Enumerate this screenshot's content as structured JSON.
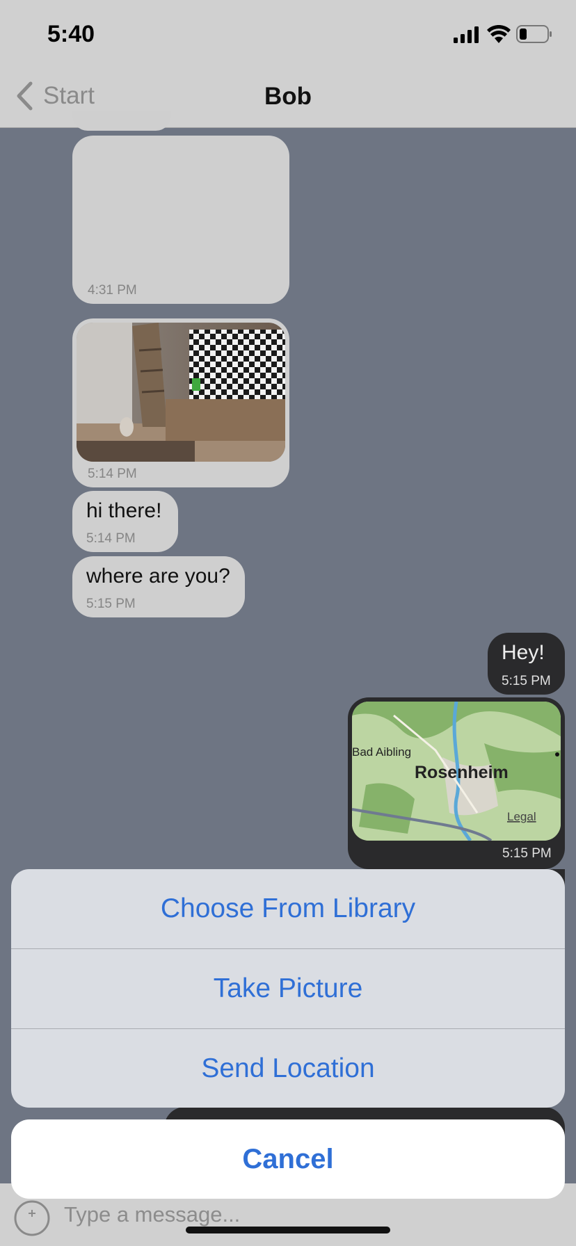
{
  "status": {
    "time": "5:40"
  },
  "nav": {
    "back_label": "Start",
    "title": "Bob"
  },
  "messages": [
    {
      "kind": "blank",
      "time": "4:31 PM"
    },
    {
      "kind": "photo",
      "time": "5:14 PM"
    },
    {
      "kind": "text",
      "text": "hi there!",
      "time": "5:14 PM"
    },
    {
      "kind": "text",
      "text": "where are you?",
      "time": "5:15 PM"
    },
    {
      "kind": "text",
      "text": "Hey!",
      "time": "5:15 PM"
    },
    {
      "kind": "map",
      "time": "5:15 PM",
      "map_labels": {
        "town1": "Bad Aibling",
        "city": "Rosenheim",
        "legal": "Legal"
      }
    }
  ],
  "action_sheet": {
    "items": [
      "Choose From Library",
      "Take Picture",
      "Send Location"
    ],
    "cancel": "Cancel"
  },
  "input": {
    "placeholder": "Type a message..."
  },
  "colors": {
    "accent": "#2f6fd6",
    "incoming_bubble": "#cfcfcf",
    "outgoing_bubble": "#2a2a2c",
    "chat_bg": "#6e7583"
  }
}
